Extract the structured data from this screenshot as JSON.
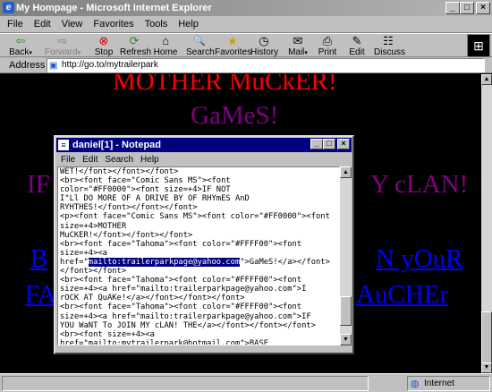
{
  "ie": {
    "title": "My Hompage - Microsoft Internet Explorer",
    "menu": [
      "File",
      "Edit",
      "View",
      "Favorites",
      "Tools",
      "Help"
    ],
    "toolbar": [
      {
        "label": "Back",
        "icon": "back-arrow-icon",
        "glyph": "⇦"
      },
      {
        "label": "Forward",
        "icon": "forward-arrow-icon",
        "glyph": "⇨"
      },
      {
        "label": "Stop",
        "icon": "stop-icon",
        "glyph": "⊗"
      },
      {
        "label": "Refresh",
        "icon": "refresh-icon",
        "glyph": "⟳"
      },
      {
        "label": "Home",
        "icon": "home-icon",
        "glyph": "⌂"
      },
      {
        "label": "Search",
        "icon": "search-icon",
        "glyph": "🔍"
      },
      {
        "label": "Favorites",
        "icon": "favorites-icon",
        "glyph": "★"
      },
      {
        "label": "History",
        "icon": "history-icon",
        "glyph": "◷"
      },
      {
        "label": "Mail",
        "icon": "mail-icon",
        "glyph": "✉"
      },
      {
        "label": "Print",
        "icon": "print-icon",
        "glyph": "⎙"
      },
      {
        "label": "Edit",
        "icon": "edit-icon",
        "glyph": "✎"
      },
      {
        "label": "Discuss",
        "icon": "discuss-icon",
        "glyph": "☷"
      }
    ],
    "address_label": "Address",
    "address_value": "http://go.to/mytrailerpark",
    "status_zone": "Internet"
  },
  "page": {
    "heading1": "MOTHER MuCkER!",
    "heading2": "GaMeS!",
    "heading3_left": "IF",
    "heading3_right": "Y cLAN!",
    "link1_left": "B",
    "link1_right": "N yOuR",
    "link2_left": "FA",
    "link2_right": "AuCHEr",
    "colors": {
      "red": "#ff0000",
      "purple": "#800080",
      "blue": "#0000ff"
    }
  },
  "notepad": {
    "title": "daniel[1] - Notepad",
    "menu": [
      "File",
      "Edit",
      "Search",
      "Help"
    ],
    "lines": [
      "WET!</font></font></font>",
      "<br><font face=\"Comic Sans MS\"><font",
      "color=\"#FF0000\"><font size=+4>IF NOT",
      "I\"Ll DO MORE OF A DRIVE BY OF RHYmES AnD",
      "RYHTHES!</font></font></font>",
      "<p><font face=\"Comic Sans MS\"><font color=\"#FF0000\"><font",
      "size=+4>MOTHER",
      "MuCKER!</font></font></font>",
      "<br><font face=\"Tahoma\"><font color=\"#FFFF00\"><font",
      "size=+4><a",
      "href=\"mailto:trailerparkpage@yahoo.com\">GaMeS!</a></font>",
      "</font></font>",
      "<br><font face=\"Tahoma\"><font color=\"#FFFF00\"><font",
      "size=+4><a href=\"mailto:trailerparkpage@yahoo.com\">I",
      "rOCK AT QuAKe!</a></font></font></font>",
      "<br><font face=\"Tahoma\"><font color=\"#FFFF00\"><font",
      "size=+4><a href=\"mailto:trailerparkpage@yahoo.com\">IF",
      "YOU WaNT To JOIN MY cLAN! THE</a></font></font></font>",
      "<br><font size=+4><a",
      "href=\"mailto:mytrailerpark@hotmail.com\">BASE"
    ],
    "selected_line_index": 10,
    "selected_text": "mailto:trailerparkpage@yahoo.com",
    "selected_prefix": "href=\"",
    "selected_suffix": "\">GaMeS!</a></font>"
  }
}
